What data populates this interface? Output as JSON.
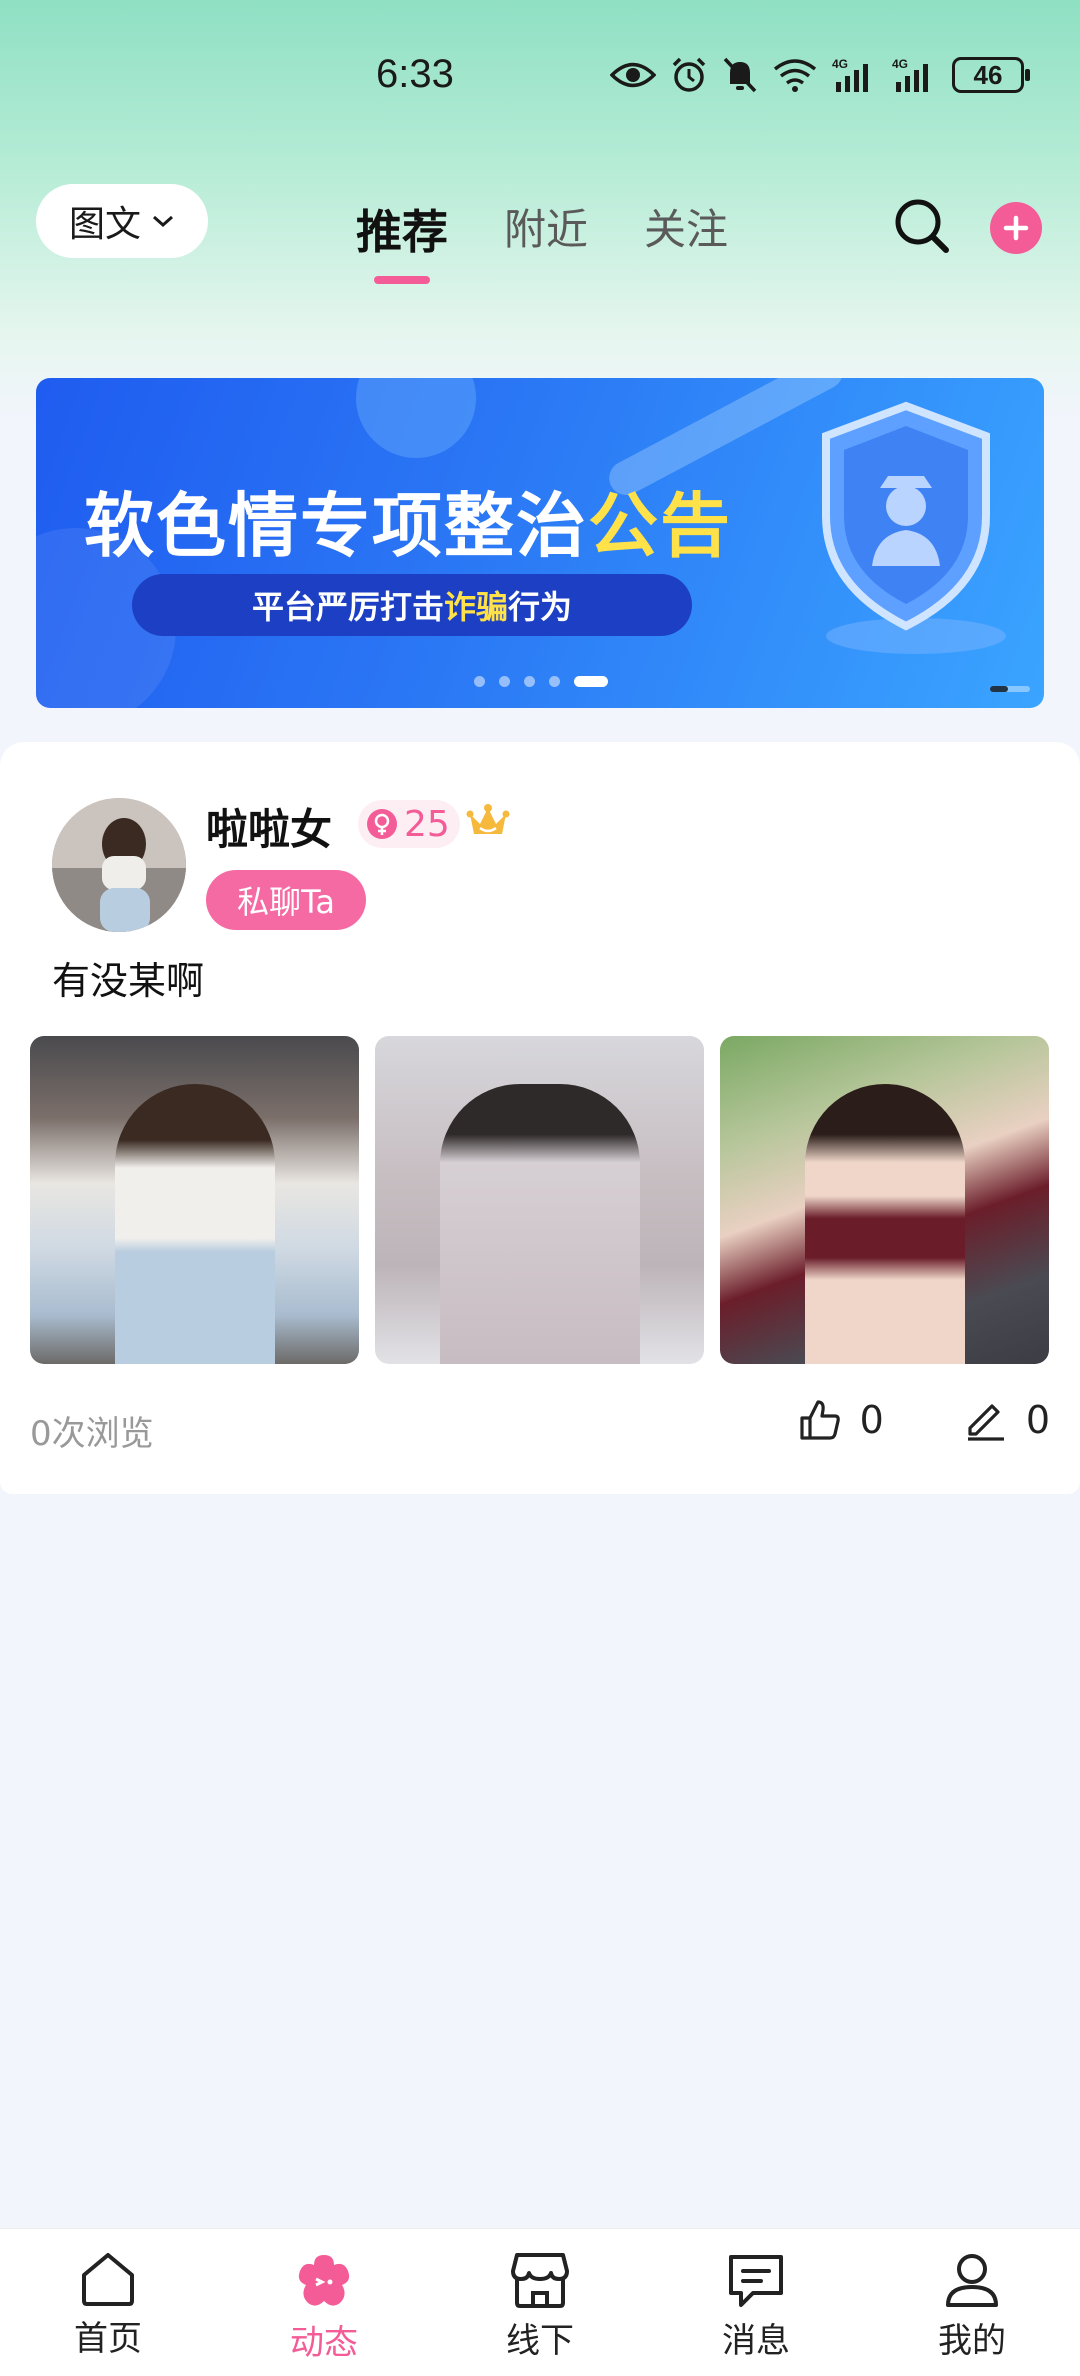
{
  "status_bar": {
    "time": "6:33",
    "battery": "46",
    "network_labels": [
      "4G",
      "4G"
    ]
  },
  "header": {
    "mode_select": "图文",
    "tabs": [
      {
        "label": "推荐",
        "active": true
      },
      {
        "label": "附近",
        "active": false
      },
      {
        "label": "关注",
        "active": false
      }
    ],
    "accent_color": "#f35c97"
  },
  "banner": {
    "title_main": "软色情专项整治",
    "title_highlight": "公告",
    "subtitle_a": "平台严厉打击",
    "subtitle_highlight": "诈骗",
    "subtitle_b": "行为",
    "slide_count": 5,
    "active_slide": 5
  },
  "post": {
    "username": "啦啦女",
    "age": "25",
    "chat_button": "私聊Ta",
    "text": "有没某啊",
    "photo_count": 3,
    "views": "0次浏览",
    "likes": "0",
    "comments": "0"
  },
  "bottom_nav": [
    {
      "label": "首页",
      "icon": "home-icon",
      "active": false
    },
    {
      "label": "动态",
      "icon": "flower-icon",
      "active": true
    },
    {
      "label": "线下",
      "icon": "store-icon",
      "active": false
    },
    {
      "label": "消息",
      "icon": "message-icon",
      "active": false
    },
    {
      "label": "我的",
      "icon": "profile-icon",
      "active": false
    }
  ]
}
